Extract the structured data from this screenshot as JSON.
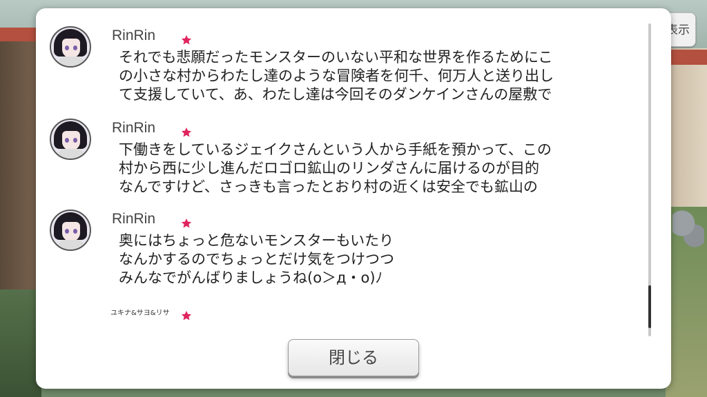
{
  "background": {
    "display_button_label": "表示"
  },
  "colors": {
    "star": "#e0245e",
    "dialog_bg": "#ffffff",
    "text": "#222222"
  },
  "messages": [
    {
      "name": "RinRin",
      "text": "それでも悲願だったモンスターのいない平和な世界を作るためにこ\nの小さな村からわたし達のような冒険者を何千、何万人と送り出し\nて支援していて、あ、わたし達は今回そのダンケインさんの屋敷で"
    },
    {
      "name": "RinRin",
      "text": "下働きをしているジェイクさんという人から手紙を預かって、この\n村から西に少し進んだロゴロ鉱山のリンダさんに届けるのが目的\nなんですけど、さっきも言ったとおり村の近くは安全でも鉱山の"
    },
    {
      "name": "RinRin",
      "text": "奥にはちょっと危ないモンスターもいたり\nなんかするのでちょっとだけ気をつけつつ\nみんなでがんばりましょうね(o＞д・o)ﾉ"
    }
  ],
  "next_sender": "ユキナ&サヨ&リサ",
  "close_button_label": "閉じる"
}
